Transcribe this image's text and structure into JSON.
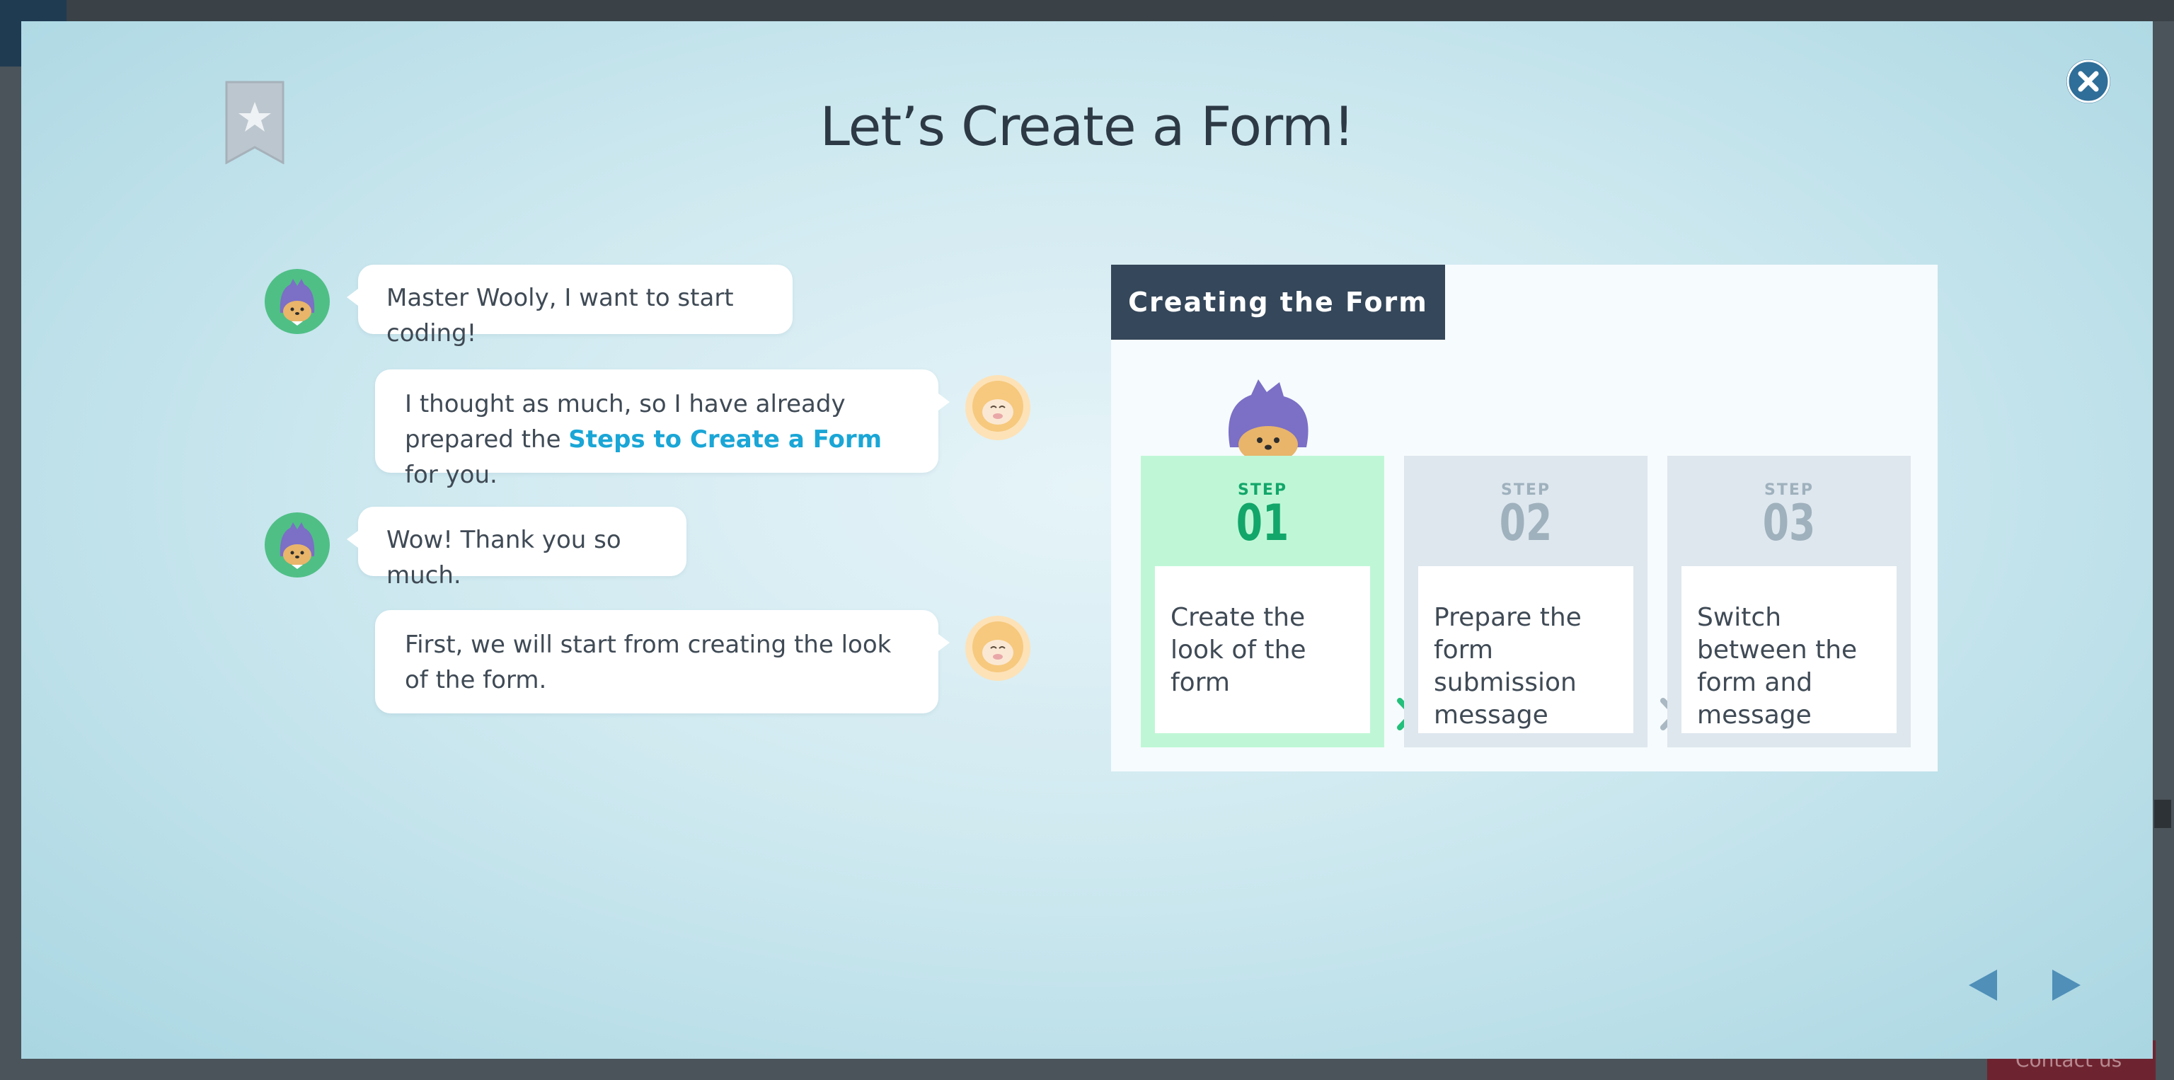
{
  "modal": {
    "title": "Let’s Create a Form!"
  },
  "chat": [
    {
      "speaker": "student",
      "parts": [
        "Master Wooly, I want to start coding!"
      ]
    },
    {
      "speaker": "master",
      "text_before": "I thought as much, so I have already prepared the ",
      "link": "Steps to Create a Form",
      "text_after": " for you."
    },
    {
      "speaker": "student",
      "parts": [
        "Wow! Thank you so much."
      ]
    },
    {
      "speaker": "master",
      "parts": [
        "First, we will start from creating the look of the form."
      ]
    }
  ],
  "panel": {
    "header": "Creating the Form",
    "steps": [
      {
        "label": "STEP",
        "number": "01",
        "text": "Create the look of the form",
        "active": true
      },
      {
        "label": "STEP",
        "number": "02",
        "text": "Prepare the form submission message",
        "active": false
      },
      {
        "label": "STEP",
        "number": "03",
        "text": "Switch between the form and message",
        "active": false
      }
    ]
  },
  "background": {
    "contact_label": "Contact us"
  },
  "icons": {
    "bookmark": "bookmark-star-icon",
    "close": "close-icon",
    "prev": "triangle-left-icon",
    "next": "triangle-right-icon"
  },
  "colors": {
    "accent_link": "#1aa6d6",
    "header_bg": "#35475a",
    "active_step": "#bff7d6",
    "active_text": "#12a66a",
    "close_button": "#2f6e98"
  }
}
